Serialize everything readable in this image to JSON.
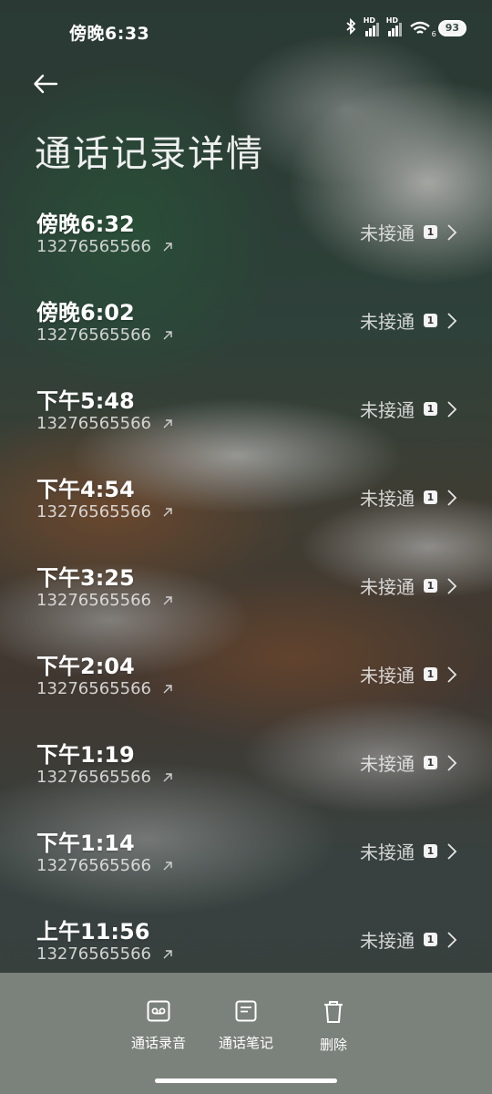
{
  "status_bar": {
    "time": "傍晚6:33",
    "signal_labels": [
      "HD",
      "HD"
    ],
    "wifi_label": "6",
    "battery": "93"
  },
  "header": {
    "title": "通话记录详情"
  },
  "calls": [
    {
      "time": "傍晚6:32",
      "number": "13276565566",
      "status": "未接通",
      "sim": "1"
    },
    {
      "time": "傍晚6:02",
      "number": "13276565566",
      "status": "未接通",
      "sim": "1"
    },
    {
      "time": "下午5:48",
      "number": "13276565566",
      "status": "未接通",
      "sim": "1"
    },
    {
      "time": "下午4:54",
      "number": "13276565566",
      "status": "未接通",
      "sim": "1"
    },
    {
      "time": "下午3:25",
      "number": "13276565566",
      "status": "未接通",
      "sim": "1"
    },
    {
      "time": "下午2:04",
      "number": "13276565566",
      "status": "未接通",
      "sim": "1"
    },
    {
      "time": "下午1:19",
      "number": "13276565566",
      "status": "未接通",
      "sim": "1"
    },
    {
      "time": "下午1:14",
      "number": "13276565566",
      "status": "未接通",
      "sim": "1"
    },
    {
      "time": "上午11:56",
      "number": "13276565566",
      "status": "未接通",
      "sim": "1"
    }
  ],
  "actions": {
    "record": "通话录音",
    "notes": "通话笔记",
    "delete": "删除"
  },
  "colors": {
    "bottom_bar": "#7b817b"
  }
}
